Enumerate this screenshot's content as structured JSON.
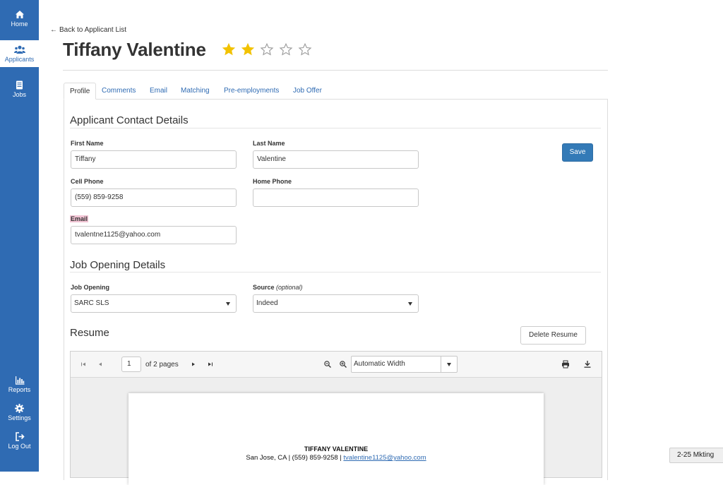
{
  "sidebar": {
    "items": [
      {
        "label": "Home",
        "icon": "home-icon"
      },
      {
        "label": "Applicants",
        "icon": "users-icon"
      },
      {
        "label": "Jobs",
        "icon": "document-icon"
      },
      {
        "label": "Reports",
        "icon": "bar-chart-icon"
      },
      {
        "label": "Settings",
        "icon": "gear-icon"
      },
      {
        "label": "Log Out",
        "icon": "logout-icon"
      }
    ],
    "active": "Applicants",
    "color": "#2f6bb3"
  },
  "header": {
    "back_label": "Back to Applicant List",
    "title": "Tiffany Valentine",
    "rating": 2,
    "rating_max": 5,
    "star_color": "#f2c200"
  },
  "tabs": [
    {
      "label": "Profile",
      "active": true
    },
    {
      "label": "Comments"
    },
    {
      "label": "Email"
    },
    {
      "label": "Matching"
    },
    {
      "label": "Pre-employments"
    },
    {
      "label": "Job Offer"
    }
  ],
  "contact": {
    "heading": "Applicant Contact Details",
    "first_name_label": "First Name",
    "first_name": "Tiffany",
    "last_name_label": "Last Name",
    "last_name": "Valentine",
    "cell_label": "Cell Phone",
    "cell": "(559) 859-9258",
    "home_label": "Home Phone",
    "home": "",
    "email_label": "Email",
    "email": "tvalentne1125@yahoo.com",
    "save_label": "Save"
  },
  "job": {
    "heading": "Job Opening Details",
    "opening_label": "Job Opening",
    "opening_value": "SARC SLS",
    "source_label": "Source",
    "source_optional": "(optional)",
    "source_value": "Indeed"
  },
  "resume": {
    "heading": "Resume",
    "delete_label": "Delete Resume",
    "viewer": {
      "page": "1",
      "page_of": "of 2 pages",
      "zoom": "Automatic Width"
    },
    "doc": {
      "name": "TIFFANY VALENTINE",
      "contact_prefix": "San Jose, CA | (559) 859-9258 | ",
      "contact_email": "tvalentine1125@yahoo.com"
    }
  },
  "corner_tip": "2-25 Mkting"
}
